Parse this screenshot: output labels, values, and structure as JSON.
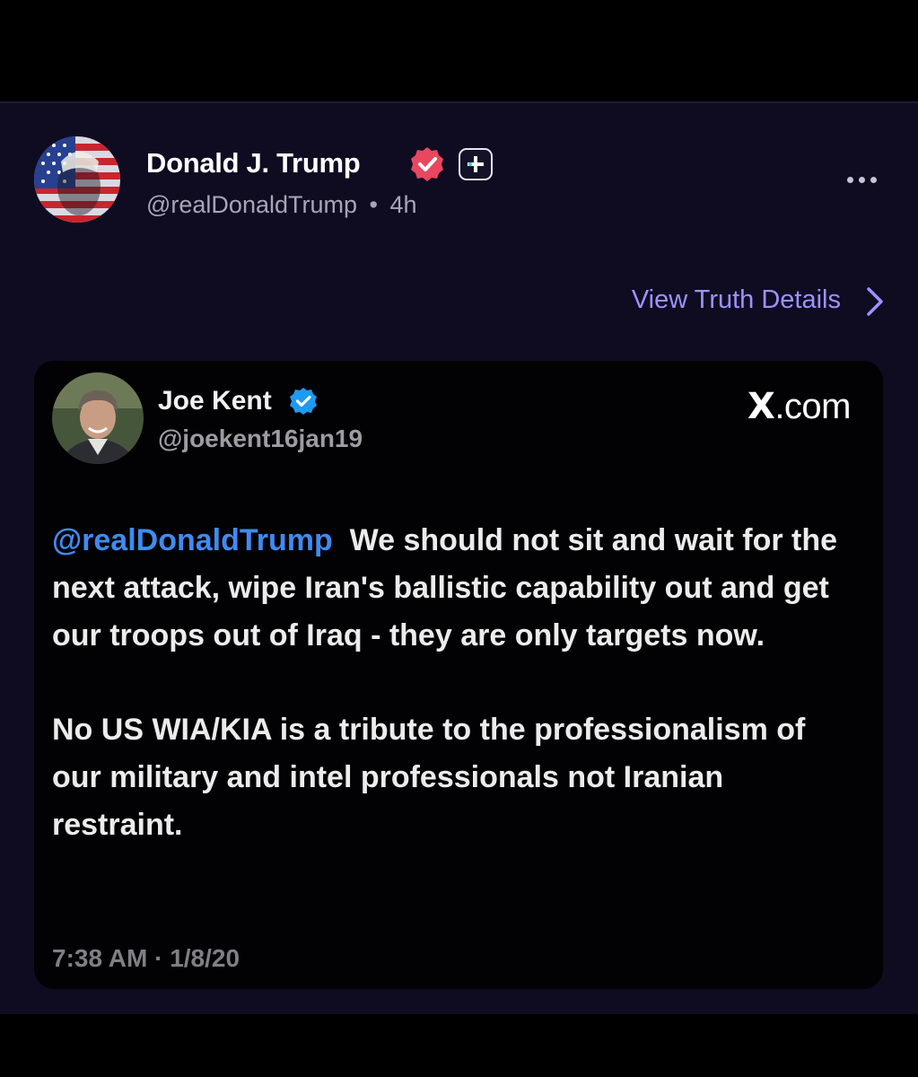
{
  "post": {
    "author_name": "Donald J. Trump",
    "handle": "@realDonaldTrump",
    "separator": "•",
    "time_ago": "4h",
    "view_details_label": "View Truth Details",
    "colors": {
      "background": "#0f0c22",
      "accent": "#9b93ff",
      "verified": "#e8475f"
    }
  },
  "embed": {
    "author_name": "Joe Kent",
    "handle": "@joekent16jan19",
    "source_x": "X",
    "source_domain": ".com",
    "body": {
      "mention": "@realDonaldTrump",
      "paragraph_1": "We should not sit and wait for the next attack, wipe Iran's ballistic capability out and get our troops out of Iraq - they are only targets now.",
      "paragraph_2": "No US WIA/KIA is a tribute to the professionalism of our military and intel professionals not Iranian restraint."
    },
    "timestamp": "7:38 AM · 1/8/20",
    "colors": {
      "mention": "#3f8bf0",
      "verified": "#1d9bf0"
    }
  }
}
